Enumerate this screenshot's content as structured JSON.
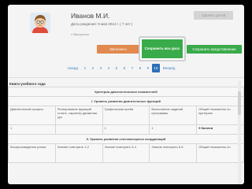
{
  "child": {
    "name": "Иванов М.И.",
    "birth_date": "Дата рождения: 9 мая 2014 г. ( 7 лет )",
    "back_link": "« Вернуться"
  },
  "header": {
    "delete_label": "Удалить детей"
  },
  "actions": {
    "fill_label": "Заполнить",
    "save_all_label": "Сохранить все доcc",
    "save_repr_label": "Сохранить представление"
  },
  "pagination": {
    "prev_label": "Назад",
    "pages": [
      "1",
      "2",
      "3",
      "4",
      "5",
      "6",
      "7",
      "8",
      "9",
      "10"
    ],
    "active_page": "10",
    "next_label": "Вперед"
  },
  "table": {
    "section_label": "Книги учебного года",
    "title_row": "Критерии диагностических показателей",
    "group1_title": "I. Уровень развития двигательных функций",
    "columns": [
      "Двигательный процесс",
      "Реагирование функций стоять, характер движения рук",
      "Графическая проба",
      "Выполнение заданий программы",
      "Общий показатель по критерию"
    ],
    "row1": [
      "1",
      "",
      "1",
      "1",
      "9 баллов"
    ],
    "group2_title": "II. Уровень развития сенсомоторных координаций",
    "row2": [
      "Воспроизведение ритма",
      "Знание повторять 1-2",
      "Знание повторять 3-4",
      "Знание повторять 5-6",
      "Общий показатель по"
    ]
  },
  "colors": {
    "fill_button": "#e1894f",
    "save_button": "#3aab4a",
    "active_page": "#2d6fb8"
  },
  "icons": {
    "avatar": "child-avatar-icon"
  }
}
